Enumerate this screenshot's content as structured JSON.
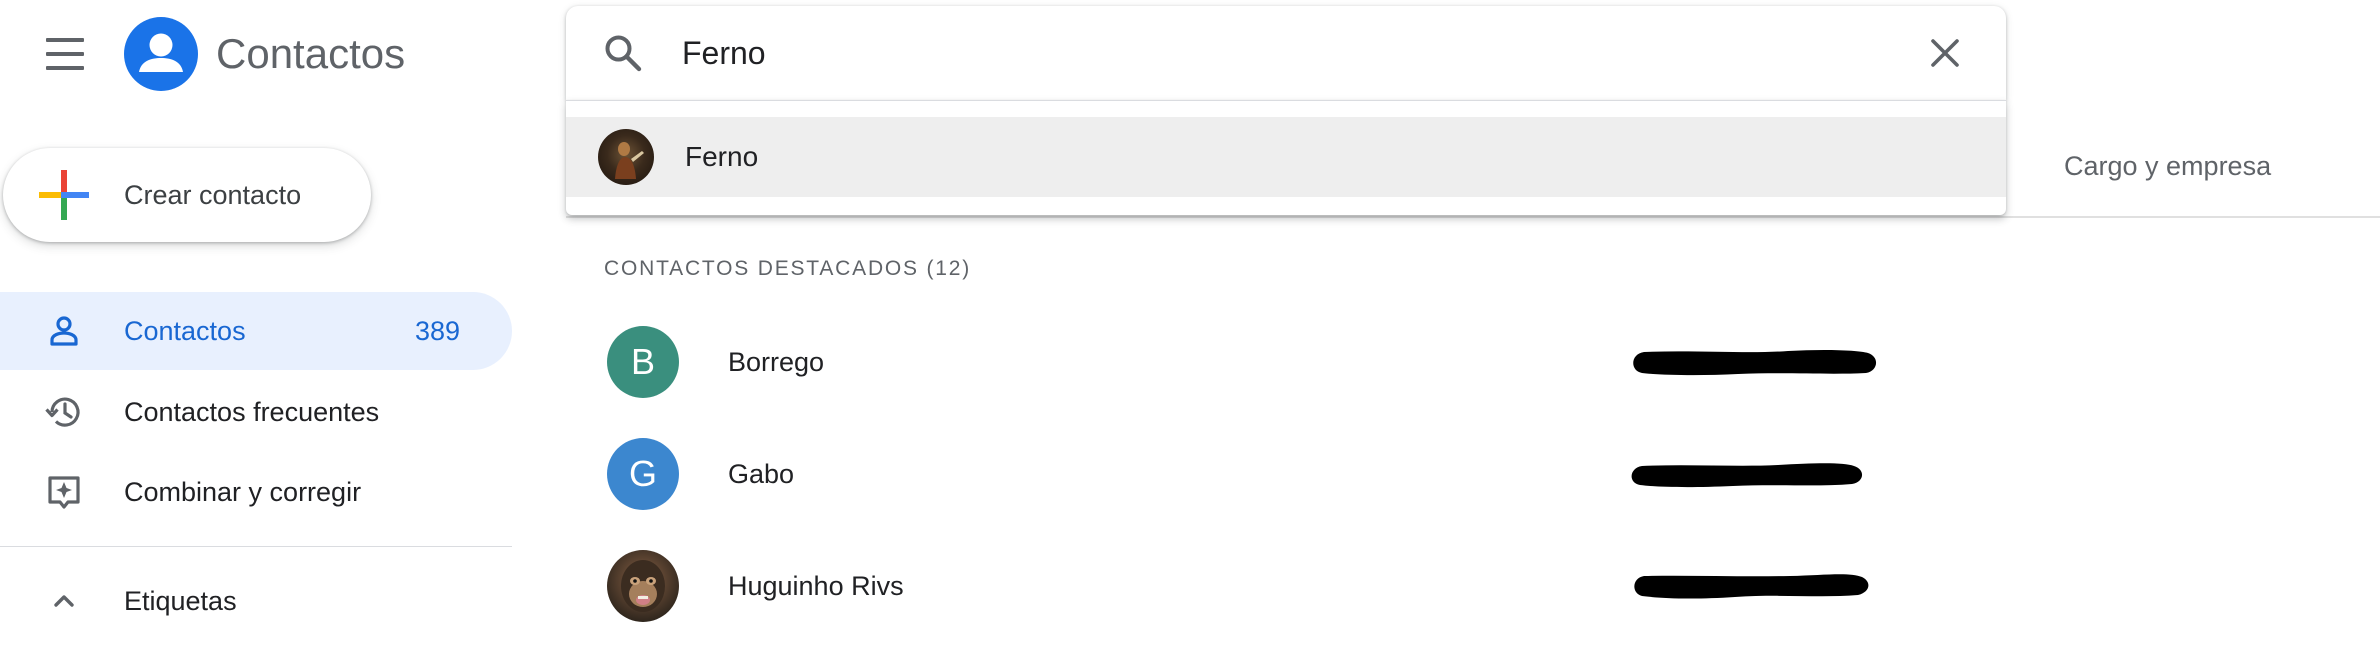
{
  "app": {
    "title": "Contactos",
    "logo_icon": "person-circle-icon",
    "menu_icon": "hamburger-menu-icon",
    "brand_color": "#1a73e8"
  },
  "create": {
    "label": "Crear contacto",
    "icon": "google-colored-plus-icon"
  },
  "sidebar": {
    "items": [
      {
        "label": "Contactos",
        "count": "389",
        "icon": "person-outline-icon",
        "selected": true
      },
      {
        "label": "Contactos frecuentes",
        "icon": "history-icon",
        "selected": false
      },
      {
        "label": "Combinar y corregir",
        "icon": "merge-sparkle-icon",
        "selected": false
      }
    ],
    "labels_section": {
      "label": "Etiquetas",
      "icon": "chevron-up-icon"
    }
  },
  "search": {
    "value": "Ferno",
    "icon": "search-icon",
    "clear_icon": "close-icon",
    "suggestions": [
      {
        "name": "Ferno",
        "avatar": "photo"
      }
    ]
  },
  "list": {
    "column_headers": {
      "job": "Cargo y empresa"
    },
    "section_title": "CONTACTOS DESTACADOS (12)",
    "contacts": [
      {
        "initial": "B",
        "name": "Borrego",
        "avatar_color": "#3a8f7e",
        "detail_redacted": true
      },
      {
        "initial": "G",
        "name": "Gabo",
        "avatar_color": "#3c87cf",
        "detail_redacted": true
      },
      {
        "initial": "",
        "name": "Huguinho Rivs",
        "avatar": "photo",
        "detail_redacted": true
      }
    ]
  }
}
